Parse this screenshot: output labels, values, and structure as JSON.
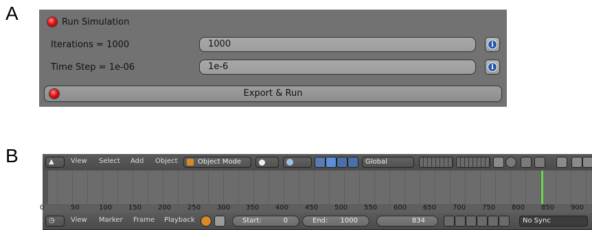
{
  "labels": {
    "a": "A",
    "b": "B"
  },
  "panel_a": {
    "run_checkbox_label": "Run Simulation",
    "iterations_label": "Iterations = 1000",
    "iterations_value": "1000",
    "timestep_label": "Time Step = 1e-06",
    "timestep_value": "1e-6",
    "export_button": "Export & Run",
    "info_glyph": "i"
  },
  "panel_b": {
    "header": {
      "menus": [
        "View",
        "Select",
        "Add",
        "Object"
      ],
      "mode": "Object Mode",
      "orientation": "Global"
    },
    "timeline": {
      "ticks": [
        "0",
        "50",
        "100",
        "150",
        "200",
        "250",
        "300",
        "350",
        "400",
        "450",
        "500",
        "550",
        "600",
        "650",
        "700",
        "750",
        "800",
        "850",
        "900"
      ],
      "current_frame": 834,
      "cursor_color": "#6ad84e"
    },
    "footer": {
      "menus": [
        "View",
        "Marker",
        "Frame",
        "Playback"
      ],
      "start_label": "Start:",
      "start_value": "0",
      "end_label": "End:",
      "end_value": "1000",
      "current_value": "834",
      "sync": "No Sync"
    }
  }
}
